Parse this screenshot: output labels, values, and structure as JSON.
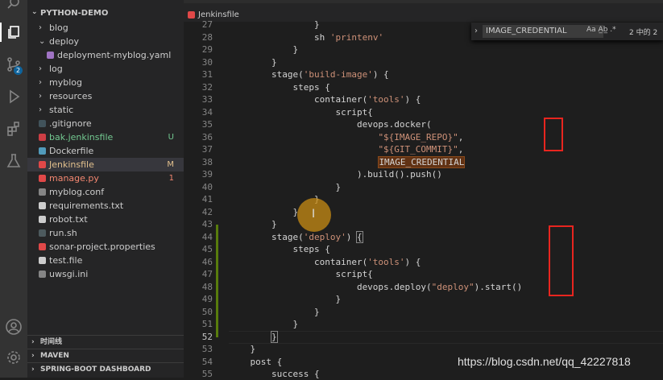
{
  "explorer": {
    "project_title": "PYTHON-DEMO",
    "items": [
      {
        "label": "blog",
        "type": "folder",
        "depth": 0
      },
      {
        "label": "deploy",
        "type": "folder-open",
        "depth": 0
      },
      {
        "label": "deployment-myblog.yaml",
        "type": "yaml",
        "depth": 1
      },
      {
        "label": "log",
        "type": "folder",
        "depth": 0
      },
      {
        "label": "myblog",
        "type": "folder",
        "depth": 0
      },
      {
        "label": "resources",
        "type": "folder",
        "depth": 0
      },
      {
        "label": "static",
        "type": "folder",
        "depth": 0
      },
      {
        "label": ".gitignore",
        "type": "git",
        "depth": 0
      },
      {
        "label": "bak.jenkinsfile",
        "type": "file",
        "depth": 0,
        "badge": "U",
        "color": "#73c991"
      },
      {
        "label": "Dockerfile",
        "type": "docker",
        "depth": 0
      },
      {
        "label": "Jenkinsfile",
        "type": "jenkins",
        "depth": 0,
        "badge": "M",
        "color": "#e2c08d",
        "selected": true
      },
      {
        "label": "manage.py",
        "type": "python",
        "depth": 0,
        "badge": "1",
        "color": "#f48771"
      },
      {
        "label": "myblog.conf",
        "type": "gear",
        "depth": 0
      },
      {
        "label": "requirements.txt",
        "type": "text",
        "depth": 0
      },
      {
        "label": "robot.txt",
        "type": "text",
        "depth": 0
      },
      {
        "label": "run.sh",
        "type": "shell",
        "depth": 0
      },
      {
        "label": "sonar-project.properties",
        "type": "sonar",
        "depth": 0
      },
      {
        "label": "test.file",
        "type": "text",
        "depth": 0
      },
      {
        "label": "uwsgi.ini",
        "type": "gear",
        "depth": 0
      }
    ],
    "panels": [
      "时间线",
      "MAVEN",
      "SPRING-BOOT DASHBOARD"
    ]
  },
  "editor": {
    "breadcrumb": "Jenkinsfile",
    "lines": [
      {
        "n": "27",
        "html": "                }"
      },
      {
        "n": "28",
        "html": "                sh <span class=\"s\">'printenv'</span>"
      },
      {
        "n": "29",
        "html": "            }"
      },
      {
        "n": "30",
        "html": "        }"
      },
      {
        "n": "31",
        "html": "        stage(<span class=\"s\">'build-image'</span>) {"
      },
      {
        "n": "32",
        "html": "            steps {"
      },
      {
        "n": "33",
        "html": "                container(<span class=\"s\">'tools'</span>) {"
      },
      {
        "n": "34",
        "html": "                    script{"
      },
      {
        "n": "35",
        "html": "                        devops.docker("
      },
      {
        "n": "36",
        "html": "                            <span class=\"s\">\"${IMAGE_REPO}\"</span>,"
      },
      {
        "n": "37",
        "html": "                            <span class=\"s\">\"${GIT_COMMIT}\"</span>,"
      },
      {
        "n": "38",
        "html": "                            <span class=\"hl\">IMAGE_CREDENTIAL</span>"
      },
      {
        "n": "39",
        "html": "                        ).build().push()"
      },
      {
        "n": "40",
        "html": "                    }"
      },
      {
        "n": "41",
        "html": "                }"
      },
      {
        "n": "42",
        "html": "            }"
      },
      {
        "n": "43",
        "html": "        }"
      },
      {
        "n": "44",
        "html": "        stage(<span class=\"s\">'deploy'</span>) <span class=\"brace-hl\">{</span>"
      },
      {
        "n": "45",
        "html": "            steps {"
      },
      {
        "n": "46",
        "html": "                container(<span class=\"s\">'tools'</span>) {"
      },
      {
        "n": "47",
        "html": "                    script{"
      },
      {
        "n": "48",
        "html": "                        devops.deploy(<span class=\"s\">\"deploy\"</span>).start()"
      },
      {
        "n": "49",
        "html": "                    }"
      },
      {
        "n": "50",
        "html": "                }"
      },
      {
        "n": "51",
        "html": "            }"
      },
      {
        "n": "52",
        "html": "        <span class=\"brace-hl\">}</span>"
      },
      {
        "n": "53",
        "html": "    }"
      },
      {
        "n": "54",
        "html": "    post {"
      },
      {
        "n": "55",
        "html": "        success {"
      }
    ]
  },
  "find": {
    "query": "IMAGE_CREDENTIAL",
    "options": "Aa  A̲b̲  .*",
    "count": "2 中的 2"
  },
  "watermark": "https://blog.csdn.net/qq_42227818",
  "colors": {
    "activity_bar": "#333333",
    "sidebar": "#252526",
    "editor": "#1e1e1e",
    "annotation_red": "#e8251f",
    "cursor_highlight": "#c88c14"
  }
}
